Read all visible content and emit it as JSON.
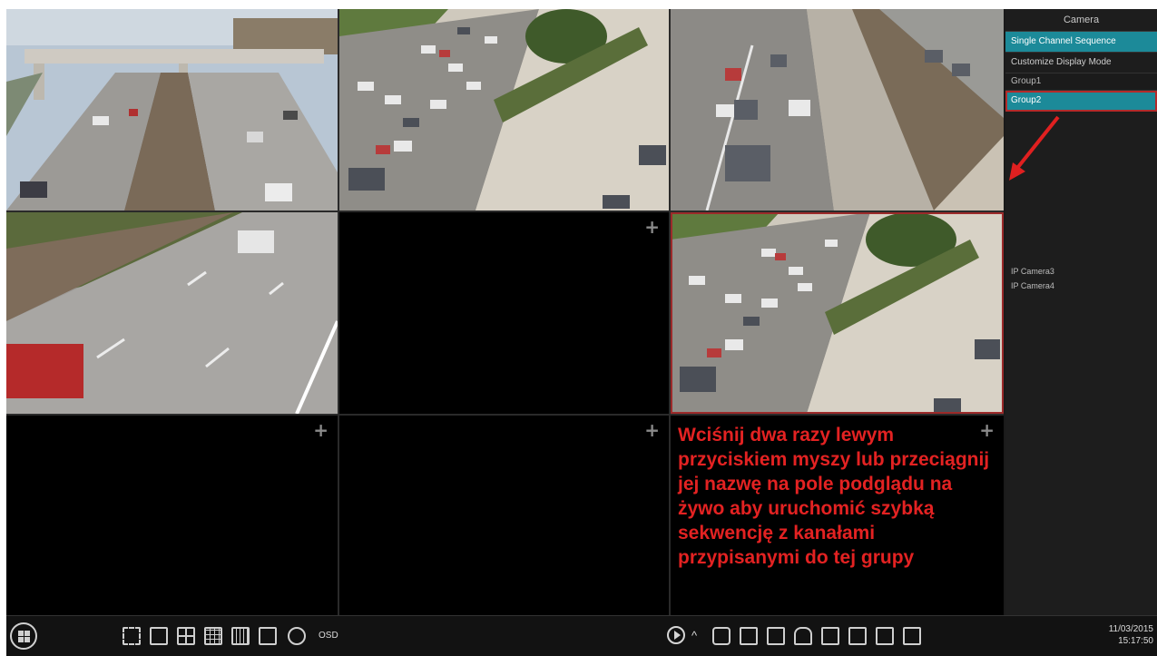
{
  "panel": {
    "title": "Camera",
    "items": [
      {
        "label": "Single Channel Sequence"
      },
      {
        "label": "Customize Display Mode"
      }
    ],
    "groups": [
      "Group1",
      "Group2"
    ],
    "cameras": [
      "IP Camera3",
      "IP Camera4"
    ]
  },
  "overlay": {
    "instruction": "Wciśnij dwa razy lewym przyciskiem myszy lub przeciągnij jej nazwę na pole podglądu na żywo aby uruchomić szybką sekwencję z kanałami przypisanymi do tej grupy"
  },
  "grid": {
    "empty_tile_icon": "plus-icon",
    "tile_add_symbol": "+"
  },
  "taskbar": {
    "osd_label": "OSD",
    "date": "11/03/2015",
    "time": "15:17:50"
  },
  "colors": {
    "accent": "#1c8a99",
    "selection": "#b42a2a",
    "instruction_text": "#e32222"
  }
}
